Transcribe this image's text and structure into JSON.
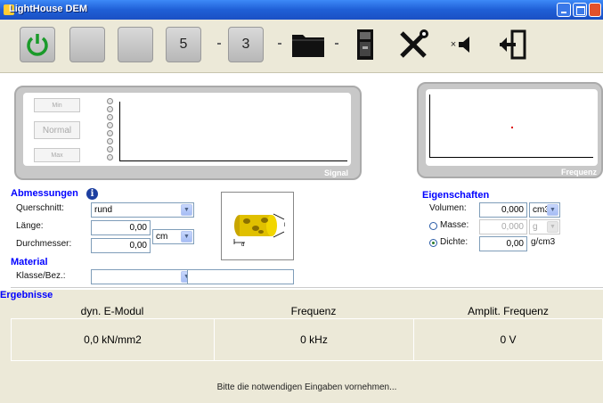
{
  "window": {
    "title": "LightHouse DEM"
  },
  "toolbar": {
    "buttons": [
      {
        "name": "power-button",
        "icon": "power-icon",
        "label": ""
      },
      {
        "name": "blank-button-1",
        "icon": "",
        "label": ""
      },
      {
        "name": "blank-button-2",
        "icon": "",
        "label": ""
      },
      {
        "name": "count-button-5",
        "icon": "",
        "label": "5"
      },
      {
        "name": "count-button-3",
        "icon": "",
        "label": "3"
      },
      {
        "name": "open-folder-button",
        "icon": "folder-icon",
        "label": ""
      },
      {
        "name": "device-button",
        "icon": "device-icon",
        "label": ""
      },
      {
        "name": "settings-tools-button",
        "icon": "tools-icon",
        "label": ""
      },
      {
        "name": "speaker-button",
        "icon": "speaker-icon",
        "label": "×"
      },
      {
        "name": "exit-button",
        "icon": "exit-door-icon",
        "label": ""
      }
    ]
  },
  "signal": {
    "label": "Signal",
    "level_buttons": {
      "min": "Min",
      "normal": "Normal",
      "max": "Max"
    }
  },
  "frequency_plot": {
    "label": "Frequenz"
  },
  "abmessungen": {
    "title": "Abmessungen",
    "querschnitt_label": "Querschnitt:",
    "querschnitt_value": "rund",
    "laenge_label": "Länge:",
    "laenge_value": "0,00",
    "durchmesser_label": "Durchmesser:",
    "durchmesser_value": "0,00",
    "unit_value": "cm"
  },
  "material": {
    "title": "Material",
    "klasse_label": "Klasse/Bez.:",
    "klasse_value": "",
    "bezeichnung_value": ""
  },
  "eigenschaften": {
    "title": "Eigenschaften",
    "volumen_label": "Volumen:",
    "volumen_value": "0,000",
    "volumen_unit": "cm3",
    "masse_label": "Masse:",
    "masse_value": "0,000",
    "masse_unit": "g",
    "dichte_label": "Dichte:",
    "dichte_value": "0,00",
    "dichte_unit": "g/cm3"
  },
  "ergebnisse": {
    "title": "Ergebnisse",
    "columns": [
      {
        "header": "dyn. E-Modul",
        "value": "0,0 kN/mm2"
      },
      {
        "header": "Frequenz",
        "value": "0 kHz"
      },
      {
        "header": "Amplit. Frequenz",
        "value": "0 V"
      }
    ]
  },
  "status": "Bitte die notwendigen Eingaben vornehmen...",
  "colors": {
    "accent": "#0000ff",
    "panel": "#ece9d8",
    "titlebar": "#1f5fd6"
  }
}
